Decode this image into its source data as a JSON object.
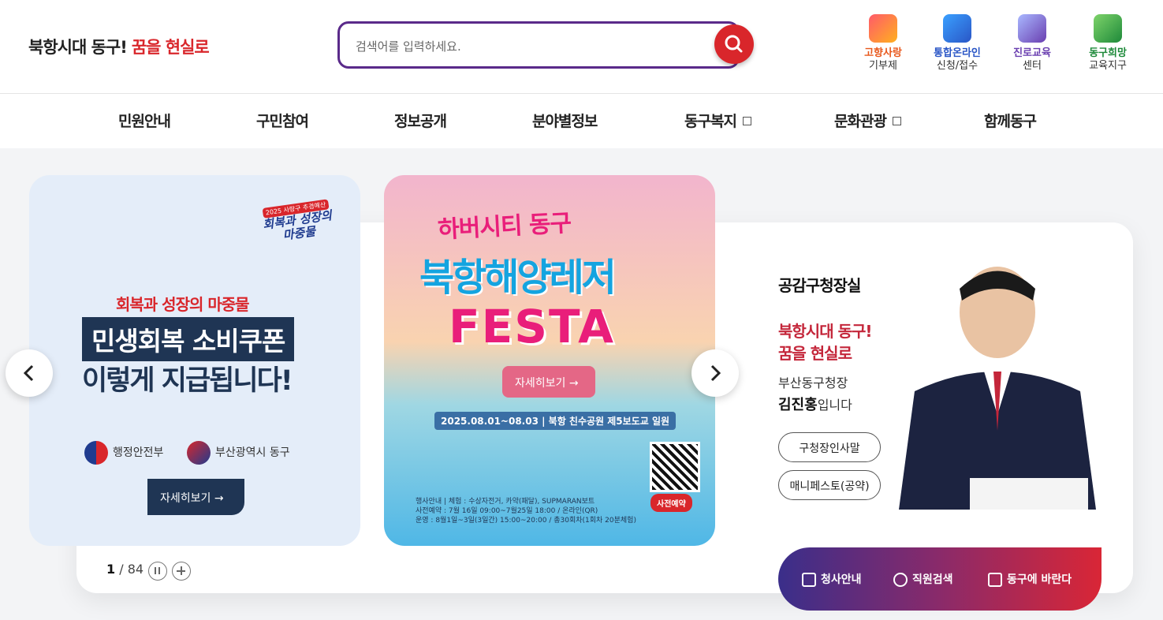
{
  "header": {
    "slogan_a": "북항시대 동구!",
    "slogan_b": "꿈을 현실로",
    "search_placeholder": "검색어를 입력하세요.",
    "quick_links": [
      {
        "title": "고향사랑",
        "sub": "기부제",
        "color": "#e8581c"
      },
      {
        "title": "통합온라인",
        "sub": "신청/접수",
        "color": "#2a56c6"
      },
      {
        "title": "진로교육",
        "sub": "센터",
        "color": "#6a3fb0"
      },
      {
        "title": "동구희망",
        "sub": "교육지구",
        "color": "#1e8a3a"
      }
    ]
  },
  "nav": [
    "민원안내",
    "구민참여",
    "정보공개",
    "분야별정보",
    "동구복지",
    "문화관광",
    "함께동구"
  ],
  "slide1": {
    "badge_small": "2025 사랑구 추경예산",
    "badge_main": "회복과 성장의 마중물",
    "subtitle": "회복과 성장의 마중물",
    "line1": "민생회복 소비쿠폰",
    "line2": "이렇게 지급됩니다!",
    "org1": "행정안전부",
    "org2": "부산광역시 동구",
    "button": "자세히보기"
  },
  "slide2": {
    "title1": "하버시티 동구",
    "title2": "북항해양레저",
    "title3": "FESTA",
    "button": "자세히보기",
    "date": "2025.08.01~08.03 | 북항 친수공원 제5보도교 일원",
    "reserve": "사전예약",
    "info1": "행사안내 | 체험 : 수상자전거, 카약(패달), SUPMARAN보트",
    "info2": "사전예약 : 7월 16일 09:00~7월25일 18:00 / 온라인(QR)",
    "info3": "운영 : 8월1일~3일(3일간) 15:00~20:00 / 총30회차(1회차 20분체험)"
  },
  "pager": {
    "current": "1",
    "total": "84"
  },
  "mayor": {
    "title": "공감구청장실",
    "slogan1": "북항시대 동구!",
    "slogan2": "꿈을 현실로",
    "position": "부산동구청장",
    "name": "김진홍",
    "suffix": "입니다",
    "btn1": "구청장인사말",
    "btn2": "매니페스토(공약)"
  },
  "bottom_links": [
    "청사안내",
    "직원검색",
    "동구에 바란다"
  ]
}
